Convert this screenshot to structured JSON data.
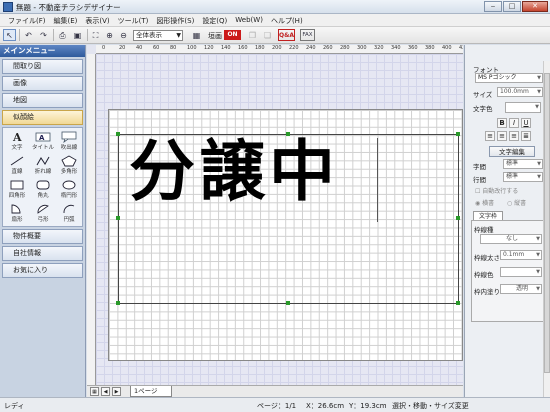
{
  "window": {
    "title": "無題 - 不動産チラシデザイナー",
    "close": "✕",
    "min": "‒",
    "max": "□"
  },
  "menu": [
    "ファイル(F)",
    "編集(E)",
    "表示(V)",
    "ツール(T)",
    "図形操作(S)",
    "設定(Q)",
    "Web(W)",
    "ヘルプ(H)"
  ],
  "toolbar": {
    "zoom_value": "全体表示",
    "grid_label": "垣画",
    "grid_state": "ON",
    "qa_label": "Q&A",
    "fax_label": "FAX"
  },
  "left_menu": {
    "header": "メインメニュー",
    "items_top": [
      "間取り図",
      "画像",
      "地図",
      "似顔絵"
    ],
    "tools": [
      "文字",
      "タイトル",
      "吹出線",
      "直線",
      "折れ線",
      "多角形",
      "四角形",
      "角丸",
      "楕円形",
      "扇形",
      "弓形",
      "円弧"
    ],
    "items_bottom": [
      "物件概要",
      "自社情報",
      "お気に入り"
    ]
  },
  "ruler": {
    "ticks": [
      "0",
      "20",
      "40",
      "60",
      "80",
      "100",
      "120",
      "140",
      "160",
      "180",
      "200",
      "220",
      "240",
      "260",
      "280",
      "300",
      "320",
      "340",
      "360",
      "380",
      "400",
      "420"
    ]
  },
  "canvas": {
    "text": "分譲中"
  },
  "page_tab": {
    "label": "1ページ"
  },
  "right_panel": {
    "font_group": "フォント",
    "font_name": "MS Pゴシック",
    "size_label": "サイズ",
    "size_value": "100.0mm",
    "color_label": "文字色",
    "bold": "B",
    "italic": "I",
    "underline": "U",
    "edit_button": "文字編集",
    "char_spacing_label": "字間",
    "char_spacing_value": "標準",
    "line_spacing_label": "行間",
    "line_spacing_value": "標準",
    "auto_wrap": "自動改行する",
    "horizontal": "横書",
    "vertical": "縦書",
    "frame_tab": "文字枠",
    "frame_type_label": "枠線種",
    "frame_type_value": "なし",
    "frame_width_label": "枠線太さ",
    "frame_width_value": "0.1mm",
    "frame_color_label": "枠線色",
    "frame_fill_label": "枠内塗り",
    "frame_fill_value": "透明"
  },
  "status": {
    "left": "レディ",
    "page": "ページ：1/1",
    "x": "X：26.6cm",
    "y": "Y：19.3cm",
    "mode": "選択・移動・サイズ変更"
  }
}
